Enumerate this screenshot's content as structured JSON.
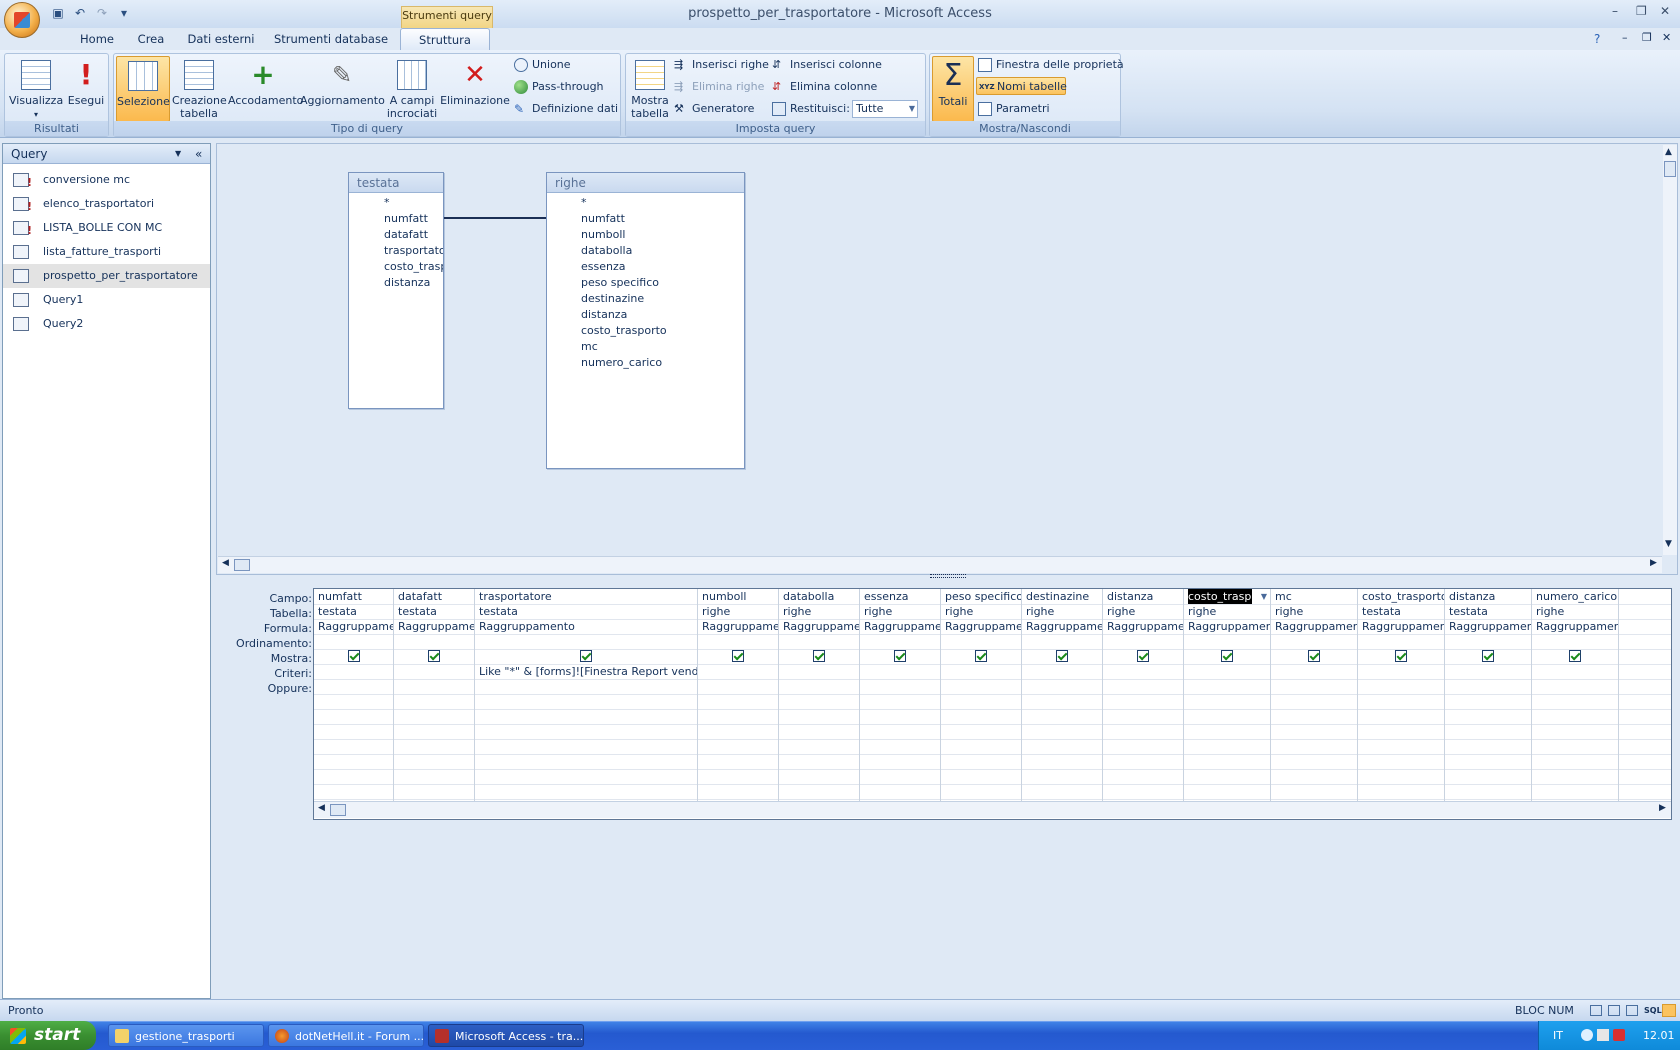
{
  "window": {
    "title": "prospetto_per_trasportatore - Microsoft Access",
    "context_tab": "Strumenti query"
  },
  "tabs": [
    "Home",
    "Crea",
    "Dati esterni",
    "Strumenti database",
    "Struttura"
  ],
  "ribbon": {
    "risultati": {
      "label": "Risultati",
      "visualizza": "Visualizza",
      "esegui": "Esegui"
    },
    "tipo_query": {
      "label": "Tipo di query",
      "selezione": "Selezione",
      "creazione_tabella_1": "Creazione",
      "creazione_tabella_2": "tabella",
      "accodamento": "Accodamento",
      "aggiornamento": "Aggiornamento",
      "a_campi_1": "A campi",
      "a_campi_2": "incrociati",
      "eliminazione": "Eliminazione",
      "unione": "Unione",
      "pass_through": "Pass-through",
      "definizione_dati": "Definizione dati"
    },
    "imposta_query": {
      "label": "Imposta query",
      "mostra_tabella_1": "Mostra",
      "mostra_tabella_2": "tabella",
      "inserisci_righe": "Inserisci righe",
      "elimina_righe": "Elimina righe",
      "generatore": "Generatore",
      "inserisci_colonne": "Inserisci colonne",
      "elimina_colonne": "Elimina colonne",
      "restituisci": "Restituisci:",
      "restituisci_value": "Tutte"
    },
    "mostra_nascondi": {
      "label": "Mostra/Nascondi",
      "totali": "Totali",
      "finestra_proprieta": "Finestra delle proprietà",
      "nomi_tabelle": "Nomi tabelle",
      "parametri": "Parametri"
    }
  },
  "nav": {
    "title": "Query",
    "items": [
      {
        "label": "conversione mc",
        "type": "action"
      },
      {
        "label": "elenco_trasportatori",
        "type": "action"
      },
      {
        "label": "LISTA_BOLLE CON MC",
        "type": "action"
      },
      {
        "label": "lista_fatture_trasporti",
        "type": "select"
      },
      {
        "label": "prospetto_per_trasportatore",
        "type": "select"
      },
      {
        "label": "Query1",
        "type": "select"
      },
      {
        "label": "Query2",
        "type": "select"
      }
    ]
  },
  "tables": [
    {
      "name": "testata",
      "fields": [
        "*",
        "numfatt",
        "datafatt",
        "trasportatore",
        "costo_trasporto",
        "distanza"
      ]
    },
    {
      "name": "righe",
      "fields": [
        "*",
        "numfatt",
        "numboll",
        "databolla",
        "essenza",
        "peso specifico",
        "destinazine",
        "distanza",
        "costo_trasporto",
        "mc",
        "numero_carico"
      ]
    }
  ],
  "grid": {
    "row_labels": [
      "Campo:",
      "Tabella:",
      "Formula:",
      "Ordinamento:",
      "Mostra:",
      "Criteri:",
      "Oppure:"
    ],
    "columns": [
      {
        "campo": "numfatt",
        "tabella": "testata",
        "formula": "Raggruppamento",
        "criteri": ""
      },
      {
        "campo": "datafatt",
        "tabella": "testata",
        "formula": "Raggruppamento",
        "criteri": ""
      },
      {
        "campo": "trasportatore",
        "tabella": "testata",
        "formula": "Raggruppamento",
        "criteri": "Like \"*\" & [forms]![Finestra Report vendite_"
      },
      {
        "campo": "numboll",
        "tabella": "righe",
        "formula": "Raggruppamento",
        "criteri": ""
      },
      {
        "campo": "databolla",
        "tabella": "righe",
        "formula": "Raggruppamento",
        "criteri": ""
      },
      {
        "campo": "essenza",
        "tabella": "righe",
        "formula": "Raggruppamento",
        "criteri": ""
      },
      {
        "campo": "peso specifico",
        "tabella": "righe",
        "formula": "Raggruppamento",
        "criteri": ""
      },
      {
        "campo": "destinazine",
        "tabella": "righe",
        "formula": "Raggruppamento",
        "criteri": ""
      },
      {
        "campo": "distanza",
        "tabella": "righe",
        "formula": "Raggruppamento",
        "criteri": ""
      },
      {
        "campo": "costo_trasporto",
        "tabella": "righe",
        "formula": "Raggruppamento",
        "criteri": ""
      },
      {
        "campo": "mc",
        "tabella": "righe",
        "formula": "Raggruppamento",
        "criteri": ""
      },
      {
        "campo": "costo_trasporto",
        "tabella": "testata",
        "formula": "Raggruppamento",
        "criteri": ""
      },
      {
        "campo": "distanza",
        "tabella": "testata",
        "formula": "Raggruppamento",
        "criteri": ""
      },
      {
        "campo": "numero_carico",
        "tabella": "righe",
        "formula": "Raggruppamento",
        "criteri": ""
      }
    ]
  },
  "status": {
    "left": "Pronto",
    "right": "BLOC NUM"
  },
  "taskbar": {
    "start": "start",
    "items": [
      "gestione_trasporti",
      "dotNetHell.it - Forum ...",
      "Microsoft Access - tra..."
    ],
    "lang": "IT",
    "clock": "12.01"
  },
  "colors": {
    "accent": "#fbb94d",
    "selection": "#000000"
  }
}
